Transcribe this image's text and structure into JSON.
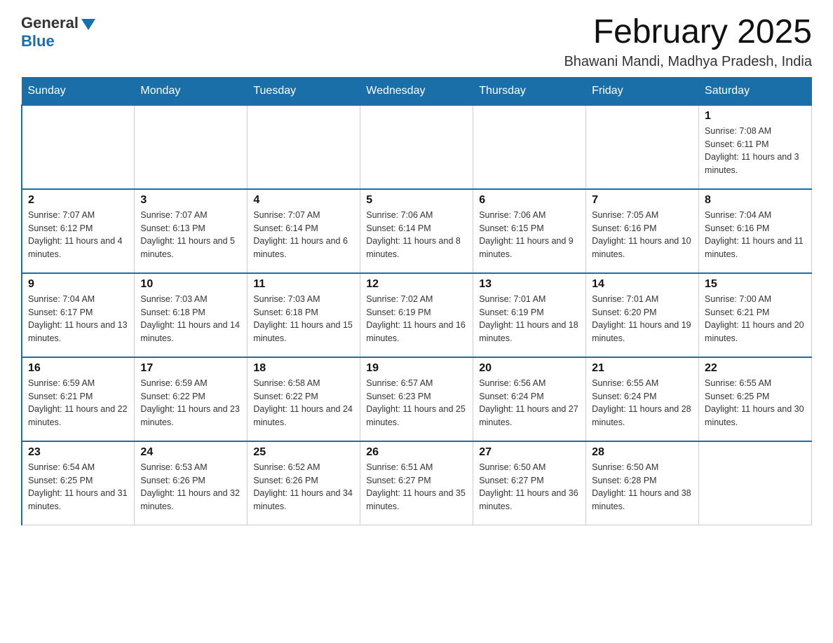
{
  "header": {
    "logo_general": "General",
    "logo_blue": "Blue",
    "title": "February 2025",
    "subtitle": "Bhawani Mandi, Madhya Pradesh, India"
  },
  "days_of_week": [
    "Sunday",
    "Monday",
    "Tuesday",
    "Wednesday",
    "Thursday",
    "Friday",
    "Saturday"
  ],
  "weeks": [
    {
      "days": [
        {
          "num": "",
          "info": ""
        },
        {
          "num": "",
          "info": ""
        },
        {
          "num": "",
          "info": ""
        },
        {
          "num": "",
          "info": ""
        },
        {
          "num": "",
          "info": ""
        },
        {
          "num": "",
          "info": ""
        },
        {
          "num": "1",
          "info": "Sunrise: 7:08 AM\nSunset: 6:11 PM\nDaylight: 11 hours and 3 minutes."
        }
      ]
    },
    {
      "days": [
        {
          "num": "2",
          "info": "Sunrise: 7:07 AM\nSunset: 6:12 PM\nDaylight: 11 hours and 4 minutes."
        },
        {
          "num": "3",
          "info": "Sunrise: 7:07 AM\nSunset: 6:13 PM\nDaylight: 11 hours and 5 minutes."
        },
        {
          "num": "4",
          "info": "Sunrise: 7:07 AM\nSunset: 6:14 PM\nDaylight: 11 hours and 6 minutes."
        },
        {
          "num": "5",
          "info": "Sunrise: 7:06 AM\nSunset: 6:14 PM\nDaylight: 11 hours and 8 minutes."
        },
        {
          "num": "6",
          "info": "Sunrise: 7:06 AM\nSunset: 6:15 PM\nDaylight: 11 hours and 9 minutes."
        },
        {
          "num": "7",
          "info": "Sunrise: 7:05 AM\nSunset: 6:16 PM\nDaylight: 11 hours and 10 minutes."
        },
        {
          "num": "8",
          "info": "Sunrise: 7:04 AM\nSunset: 6:16 PM\nDaylight: 11 hours and 11 minutes."
        }
      ]
    },
    {
      "days": [
        {
          "num": "9",
          "info": "Sunrise: 7:04 AM\nSunset: 6:17 PM\nDaylight: 11 hours and 13 minutes."
        },
        {
          "num": "10",
          "info": "Sunrise: 7:03 AM\nSunset: 6:18 PM\nDaylight: 11 hours and 14 minutes."
        },
        {
          "num": "11",
          "info": "Sunrise: 7:03 AM\nSunset: 6:18 PM\nDaylight: 11 hours and 15 minutes."
        },
        {
          "num": "12",
          "info": "Sunrise: 7:02 AM\nSunset: 6:19 PM\nDaylight: 11 hours and 16 minutes."
        },
        {
          "num": "13",
          "info": "Sunrise: 7:01 AM\nSunset: 6:19 PM\nDaylight: 11 hours and 18 minutes."
        },
        {
          "num": "14",
          "info": "Sunrise: 7:01 AM\nSunset: 6:20 PM\nDaylight: 11 hours and 19 minutes."
        },
        {
          "num": "15",
          "info": "Sunrise: 7:00 AM\nSunset: 6:21 PM\nDaylight: 11 hours and 20 minutes."
        }
      ]
    },
    {
      "days": [
        {
          "num": "16",
          "info": "Sunrise: 6:59 AM\nSunset: 6:21 PM\nDaylight: 11 hours and 22 minutes."
        },
        {
          "num": "17",
          "info": "Sunrise: 6:59 AM\nSunset: 6:22 PM\nDaylight: 11 hours and 23 minutes."
        },
        {
          "num": "18",
          "info": "Sunrise: 6:58 AM\nSunset: 6:22 PM\nDaylight: 11 hours and 24 minutes."
        },
        {
          "num": "19",
          "info": "Sunrise: 6:57 AM\nSunset: 6:23 PM\nDaylight: 11 hours and 25 minutes."
        },
        {
          "num": "20",
          "info": "Sunrise: 6:56 AM\nSunset: 6:24 PM\nDaylight: 11 hours and 27 minutes."
        },
        {
          "num": "21",
          "info": "Sunrise: 6:55 AM\nSunset: 6:24 PM\nDaylight: 11 hours and 28 minutes."
        },
        {
          "num": "22",
          "info": "Sunrise: 6:55 AM\nSunset: 6:25 PM\nDaylight: 11 hours and 30 minutes."
        }
      ]
    },
    {
      "days": [
        {
          "num": "23",
          "info": "Sunrise: 6:54 AM\nSunset: 6:25 PM\nDaylight: 11 hours and 31 minutes."
        },
        {
          "num": "24",
          "info": "Sunrise: 6:53 AM\nSunset: 6:26 PM\nDaylight: 11 hours and 32 minutes."
        },
        {
          "num": "25",
          "info": "Sunrise: 6:52 AM\nSunset: 6:26 PM\nDaylight: 11 hours and 34 minutes."
        },
        {
          "num": "26",
          "info": "Sunrise: 6:51 AM\nSunset: 6:27 PM\nDaylight: 11 hours and 35 minutes."
        },
        {
          "num": "27",
          "info": "Sunrise: 6:50 AM\nSunset: 6:27 PM\nDaylight: 11 hours and 36 minutes."
        },
        {
          "num": "28",
          "info": "Sunrise: 6:50 AM\nSunset: 6:28 PM\nDaylight: 11 hours and 38 minutes."
        },
        {
          "num": "",
          "info": ""
        }
      ]
    }
  ]
}
